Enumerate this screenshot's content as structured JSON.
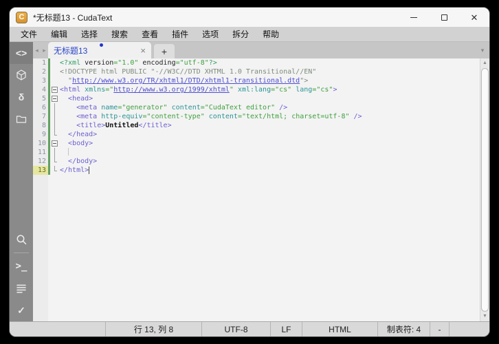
{
  "window": {
    "title": "*无标题13 - CudaText",
    "app_icon_letter": "C",
    "controls": [
      {
        "name": "minimize-button"
      },
      {
        "name": "maximize-button"
      },
      {
        "name": "close-button"
      }
    ]
  },
  "menu": {
    "items": [
      "文件",
      "编辑",
      "选择",
      "搜索",
      "查看",
      "插件",
      "选项",
      "拆分",
      "帮助"
    ]
  },
  "tabbar": {
    "nav_left": "◂",
    "nav_right": "▸",
    "active_tab": {
      "label": "无标题13",
      "modified": true,
      "close_glyph": "×"
    },
    "new_tab_glyph": "+",
    "tab_list_glyph": "▾"
  },
  "sidebar": {
    "top_icons": [
      {
        "name": "code-editor-icon",
        "kind": "text",
        "glyph": "<>",
        "active": true
      },
      {
        "name": "package-cube-icon",
        "kind": "svg-cube",
        "active": false
      },
      {
        "name": "snippets-delta-icon",
        "kind": "text",
        "glyph": "δ",
        "active": false
      },
      {
        "name": "project-folder-icon",
        "kind": "svg-folder",
        "active": false
      }
    ],
    "bottom_icons": [
      {
        "name": "search-icon",
        "kind": "svg-search"
      },
      {
        "name": "divider",
        "kind": "divider"
      },
      {
        "name": "console-icon",
        "kind": "text",
        "glyph": ">_"
      },
      {
        "name": "output-list-icon",
        "kind": "svg-list"
      },
      {
        "name": "validate-check-icon",
        "kind": "text",
        "glyph": "✓"
      }
    ]
  },
  "editor": {
    "current_line": 13,
    "caret": {
      "line": 13,
      "col": 8
    },
    "lines": [
      {
        "num": 1,
        "fold": "none",
        "modified": true,
        "segments": [
          {
            "t": "<?xml ",
            "c": "pi"
          },
          {
            "t": "version",
            "c": "plain"
          },
          {
            "t": "=\"1.0\"",
            "c": "str"
          },
          {
            "t": " encoding",
            "c": "plain"
          },
          {
            "t": "=\"utf-8\"",
            "c": "str"
          },
          {
            "t": "?>",
            "c": "pi"
          }
        ]
      },
      {
        "num": 2,
        "fold": "none",
        "modified": true,
        "segments": [
          {
            "t": "<!DOCTYPE html PUBLIC \"-//W3C//DTD XHTML 1.0 Transitional//EN\"",
            "c": "doctype"
          }
        ]
      },
      {
        "num": 3,
        "fold": "none",
        "modified": true,
        "segments": [
          {
            "t": "  \"",
            "c": "doctype"
          },
          {
            "t": "http://www.w3.org/TR/xhtml1/DTD/xhtml1-transitional.dtd",
            "c": "url"
          },
          {
            "t": "\">",
            "c": "doctype"
          }
        ]
      },
      {
        "num": 4,
        "fold": "box",
        "modified": true,
        "segments": [
          {
            "t": "<html ",
            "c": "tag"
          },
          {
            "t": "xmlns",
            "c": "attr"
          },
          {
            "t": "=\"",
            "c": "str"
          },
          {
            "t": "http://www.w3.org/1999/xhtml",
            "c": "url"
          },
          {
            "t": "\"",
            "c": "str"
          },
          {
            "t": " ",
            "c": "plain"
          },
          {
            "t": "xml:lang",
            "c": "attr"
          },
          {
            "t": "=\"cs\"",
            "c": "str"
          },
          {
            "t": " ",
            "c": "plain"
          },
          {
            "t": "lang",
            "c": "attr"
          },
          {
            "t": "=\"cs\"",
            "c": "str"
          },
          {
            "t": ">",
            "c": "tag"
          }
        ]
      },
      {
        "num": 5,
        "fold": "box",
        "modified": true,
        "segments": [
          {
            "t": "  ",
            "c": "plain"
          },
          {
            "t": "<head>",
            "c": "tag"
          }
        ]
      },
      {
        "num": 6,
        "fold": "line",
        "modified": true,
        "segments": [
          {
            "t": "    ",
            "c": "plain"
          },
          {
            "t": "<meta ",
            "c": "tag"
          },
          {
            "t": "name",
            "c": "attr"
          },
          {
            "t": "=\"generator\"",
            "c": "str"
          },
          {
            "t": " ",
            "c": "plain"
          },
          {
            "t": "content",
            "c": "attr"
          },
          {
            "t": "=\"CudaText editor\"",
            "c": "str"
          },
          {
            "t": " />",
            "c": "tag"
          }
        ]
      },
      {
        "num": 7,
        "fold": "line",
        "modified": true,
        "segments": [
          {
            "t": "    ",
            "c": "plain"
          },
          {
            "t": "<meta ",
            "c": "tag"
          },
          {
            "t": "http-equiv",
            "c": "attr"
          },
          {
            "t": "=\"content-type\"",
            "c": "str"
          },
          {
            "t": " ",
            "c": "plain"
          },
          {
            "t": "content",
            "c": "attr"
          },
          {
            "t": "=\"text/html; charset=utf-8\"",
            "c": "str"
          },
          {
            "t": " />",
            "c": "tag"
          }
        ]
      },
      {
        "num": 8,
        "fold": "line",
        "modified": true,
        "segments": [
          {
            "t": "    ",
            "c": "plain"
          },
          {
            "t": "<title>",
            "c": "tag"
          },
          {
            "t": "Untitled",
            "c": "bold"
          },
          {
            "t": "</title>",
            "c": "tag"
          }
        ]
      },
      {
        "num": 9,
        "fold": "end",
        "modified": true,
        "segments": [
          {
            "t": "  ",
            "c": "plain"
          },
          {
            "t": "</head>",
            "c": "tag"
          }
        ]
      },
      {
        "num": 10,
        "fold": "box",
        "modified": true,
        "segments": [
          {
            "t": "  ",
            "c": "plain"
          },
          {
            "t": "<body>",
            "c": "tag"
          }
        ]
      },
      {
        "num": 11,
        "fold": "line",
        "modified": true,
        "segments": [
          {
            "t": "  ",
            "c": "plain"
          },
          {
            "t": "",
            "c": "guide"
          }
        ]
      },
      {
        "num": 12,
        "fold": "end",
        "modified": true,
        "segments": [
          {
            "t": "  ",
            "c": "plain"
          },
          {
            "t": "</body>",
            "c": "tag"
          }
        ]
      },
      {
        "num": 13,
        "fold": "end",
        "modified": true,
        "segments": [
          {
            "t": "</html>",
            "c": "tag"
          }
        ]
      }
    ]
  },
  "scrollbar": {
    "up_glyph": "▲",
    "down_glyph": "▼"
  },
  "statusbar": {
    "cells": [
      {
        "name": "status-empty-left",
        "label": "",
        "width": 140
      },
      {
        "name": "status-caret-pos",
        "label": "行 13, 列 8",
        "width": 140
      },
      {
        "name": "status-encoding",
        "label": "UTF-8",
        "width": 100
      },
      {
        "name": "status-line-ends",
        "label": "LF",
        "width": 46
      },
      {
        "name": "status-lexer",
        "label": "HTML",
        "width": 110
      },
      {
        "name": "status-tab-size",
        "label": "制表符: 4",
        "width": 76
      },
      {
        "name": "status-selection",
        "label": "-",
        "width": 28
      },
      {
        "name": "status-fill",
        "label": "",
        "width": 0,
        "flex": true
      }
    ]
  },
  "colors": {
    "tab_text": "#2945c8",
    "modified_marker": "#62a062",
    "tag": "#6a5fd0",
    "attr": "#2b9393",
    "string": "#3fa03f",
    "doctype": "#7e8b7e",
    "url": "#4d4dd0",
    "xml_pi": "#2f9b62",
    "sidebar_bg": "#8a8a8a",
    "app_icon": "#e2a23c",
    "current_line_number_bg": "#e6e79e"
  }
}
